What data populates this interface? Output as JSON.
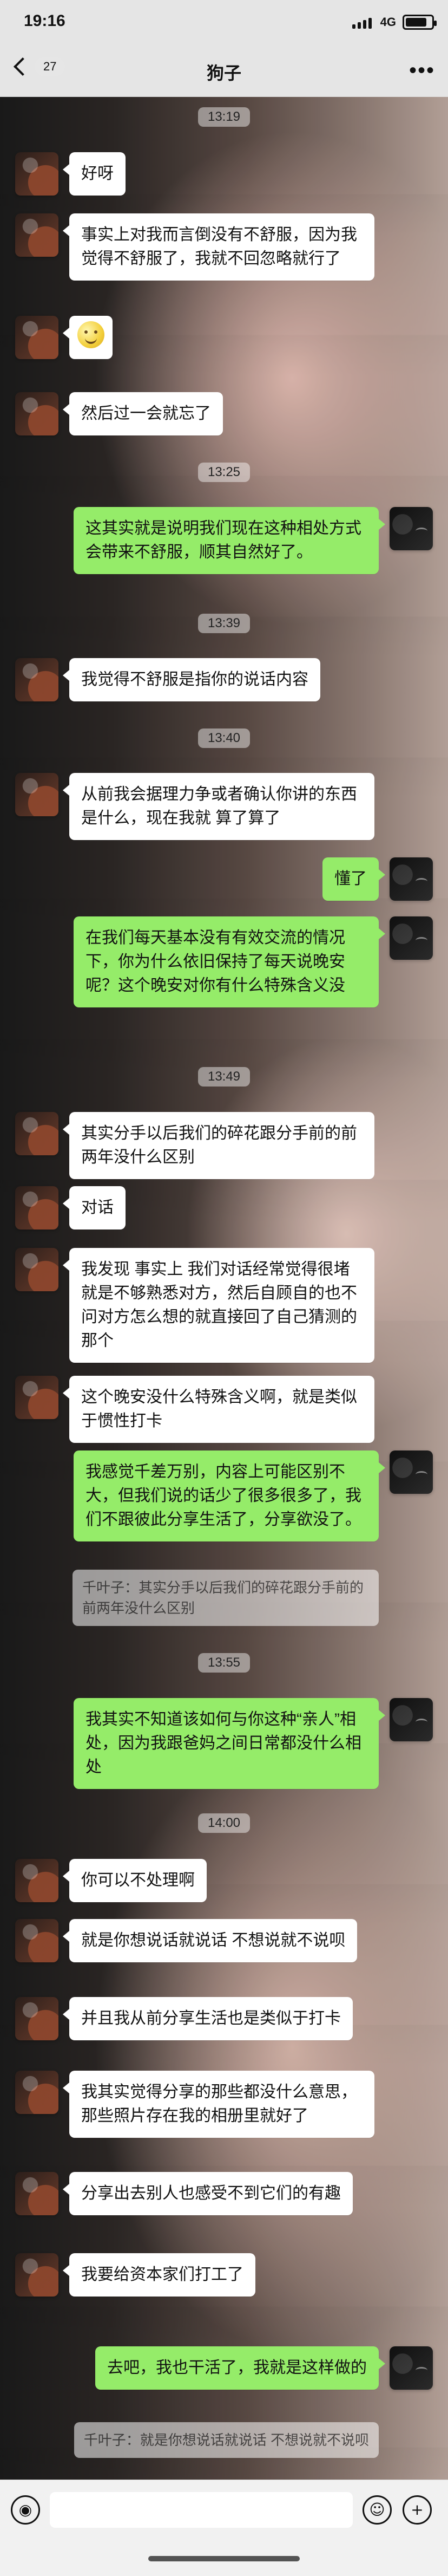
{
  "status_bar": {
    "time": "19:16",
    "network": "4G"
  },
  "header": {
    "unread_count": "27",
    "title": "狗子",
    "more_label": "•••"
  },
  "messages": [
    {
      "type": "time",
      "text": "13:19"
    },
    {
      "type": "message",
      "side": "left",
      "text": "好呀"
    },
    {
      "type": "message",
      "side": "left",
      "text": "事实上对我而言倒没有不舒服，因为我觉得不舒服了，我就不回忽略就行了"
    },
    {
      "type": "emoji",
      "side": "left",
      "emoji": "emoji-face"
    },
    {
      "type": "message",
      "side": "left",
      "text": "然后过一会就忘了"
    },
    {
      "type": "time",
      "text": "13:25"
    },
    {
      "type": "message",
      "side": "right",
      "text": "这其实就是说明我们现在这种相处方式会带来不舒服，顺其自然好了。"
    },
    {
      "type": "time",
      "text": "13:39"
    },
    {
      "type": "message",
      "side": "left",
      "text": "我觉得不舒服是指你的说话内容"
    },
    {
      "type": "time",
      "text": "13:40"
    },
    {
      "type": "message",
      "side": "left",
      "text": "从前我会据理力争或者确认你讲的东西是什么，现在我就 算了算了"
    },
    {
      "type": "message",
      "side": "right",
      "text": "懂了"
    },
    {
      "type": "message",
      "side": "right",
      "text": "在我们每天基本没有有效交流的情况下，你为什么依旧保持了每天说晚安呢？这个晚安对你有什么特殊含义没"
    },
    {
      "type": "time",
      "text": "13:49"
    },
    {
      "type": "message",
      "side": "left",
      "text": "其实分手以后我们的碎花跟分手前的前两年没什么区别"
    },
    {
      "type": "message",
      "side": "left",
      "text": "对话"
    },
    {
      "type": "message",
      "side": "left",
      "text": "我发现 事实上 我们对话经常觉得很堵就是不够熟悉对方，然后自顾自的也不问对方怎么想的就直接回了自己猜测的那个"
    },
    {
      "type": "message",
      "side": "left",
      "text": "这个晚安没什么特殊含义啊，就是类似于惯性打卡"
    },
    {
      "type": "message",
      "side": "right",
      "text": "我感觉千差万别，内容上可能区别不大，但我们说的话少了很多很多了，我们不跟彼此分享生活了，分享欲没了。"
    },
    {
      "type": "quote",
      "side": "right",
      "text": "千叶子：其实分手以后我们的碎花跟分手前的前两年没什么区别"
    },
    {
      "type": "time",
      "text": "13:55"
    },
    {
      "type": "message",
      "side": "right",
      "text": "我其实不知道该如何与你这种“亲人”相处，因为我跟爸妈之间日常都没什么相处"
    },
    {
      "type": "time",
      "text": "14:00"
    },
    {
      "type": "message",
      "side": "left",
      "text": "你可以不处理啊"
    },
    {
      "type": "message",
      "side": "left",
      "text": "就是你想说话就说话 不想说就不说呗"
    },
    {
      "type": "message",
      "side": "left",
      "text": "并且我从前分享生活也是类似于打卡"
    },
    {
      "type": "message",
      "side": "left",
      "text": "我其实觉得分享的那些都没什么意思，那些照片存在我的相册里就好了"
    },
    {
      "type": "message",
      "side": "left",
      "text": "分享出去别人也感受不到它们的有趣"
    },
    {
      "type": "message",
      "side": "left",
      "text": "我要给资本家们打工了"
    },
    {
      "type": "message",
      "side": "right",
      "text": "去吧，我也干活了，我就是这样做的"
    },
    {
      "type": "quote",
      "side": "right",
      "text": "千叶子：就是你想说话就说话 不想说就不说呗"
    }
  ],
  "input_bar": {
    "placeholder": ""
  },
  "colors": {
    "green_bubble": "#95ec69",
    "white_bubble": "#ffffff",
    "header_bg": "#f5f5f5"
  },
  "icons": {
    "back": "chevron-left-icon",
    "more": "more-icon",
    "voice": "voice-icon",
    "emoji": "emoji-icon",
    "plus": "plus-icon"
  }
}
